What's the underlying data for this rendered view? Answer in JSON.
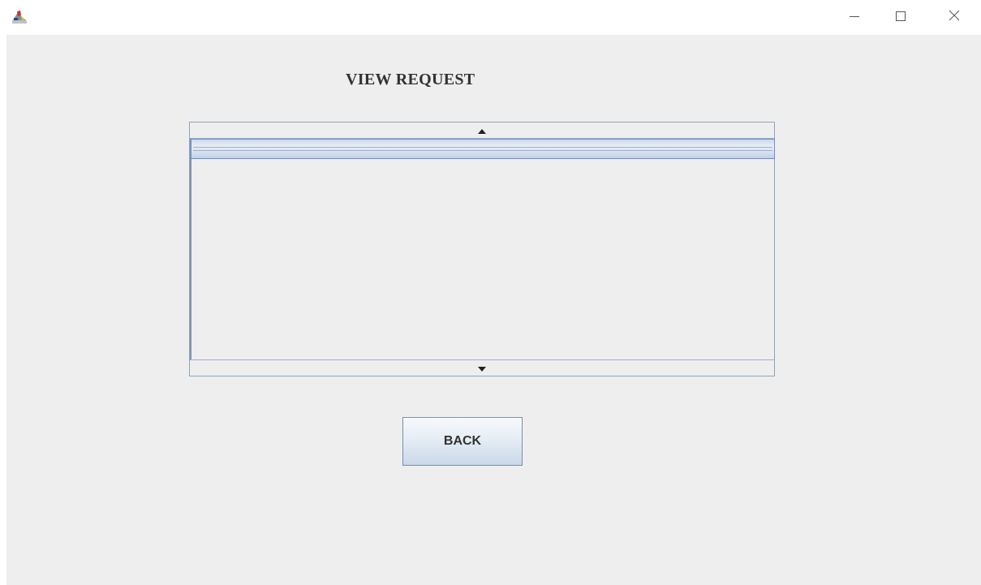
{
  "window": {
    "icon": "java-app-icon",
    "controls": {
      "minimize_icon": "minimize-icon",
      "maximize_icon": "maximize-icon",
      "close_icon": "close-icon"
    }
  },
  "page": {
    "title": "VIEW REQUEST"
  },
  "request_list": {
    "scroll_up_icon": "triangle-up-icon",
    "scroll_down_icon": "triangle-down-icon",
    "items": [
      ""
    ],
    "selected_index": 0
  },
  "actions": {
    "back_label": "BACK"
  },
  "colors": {
    "content_background": "#eeeeee",
    "selection_border": "#6b8fd1",
    "button_border": "#7a8ea8"
  }
}
